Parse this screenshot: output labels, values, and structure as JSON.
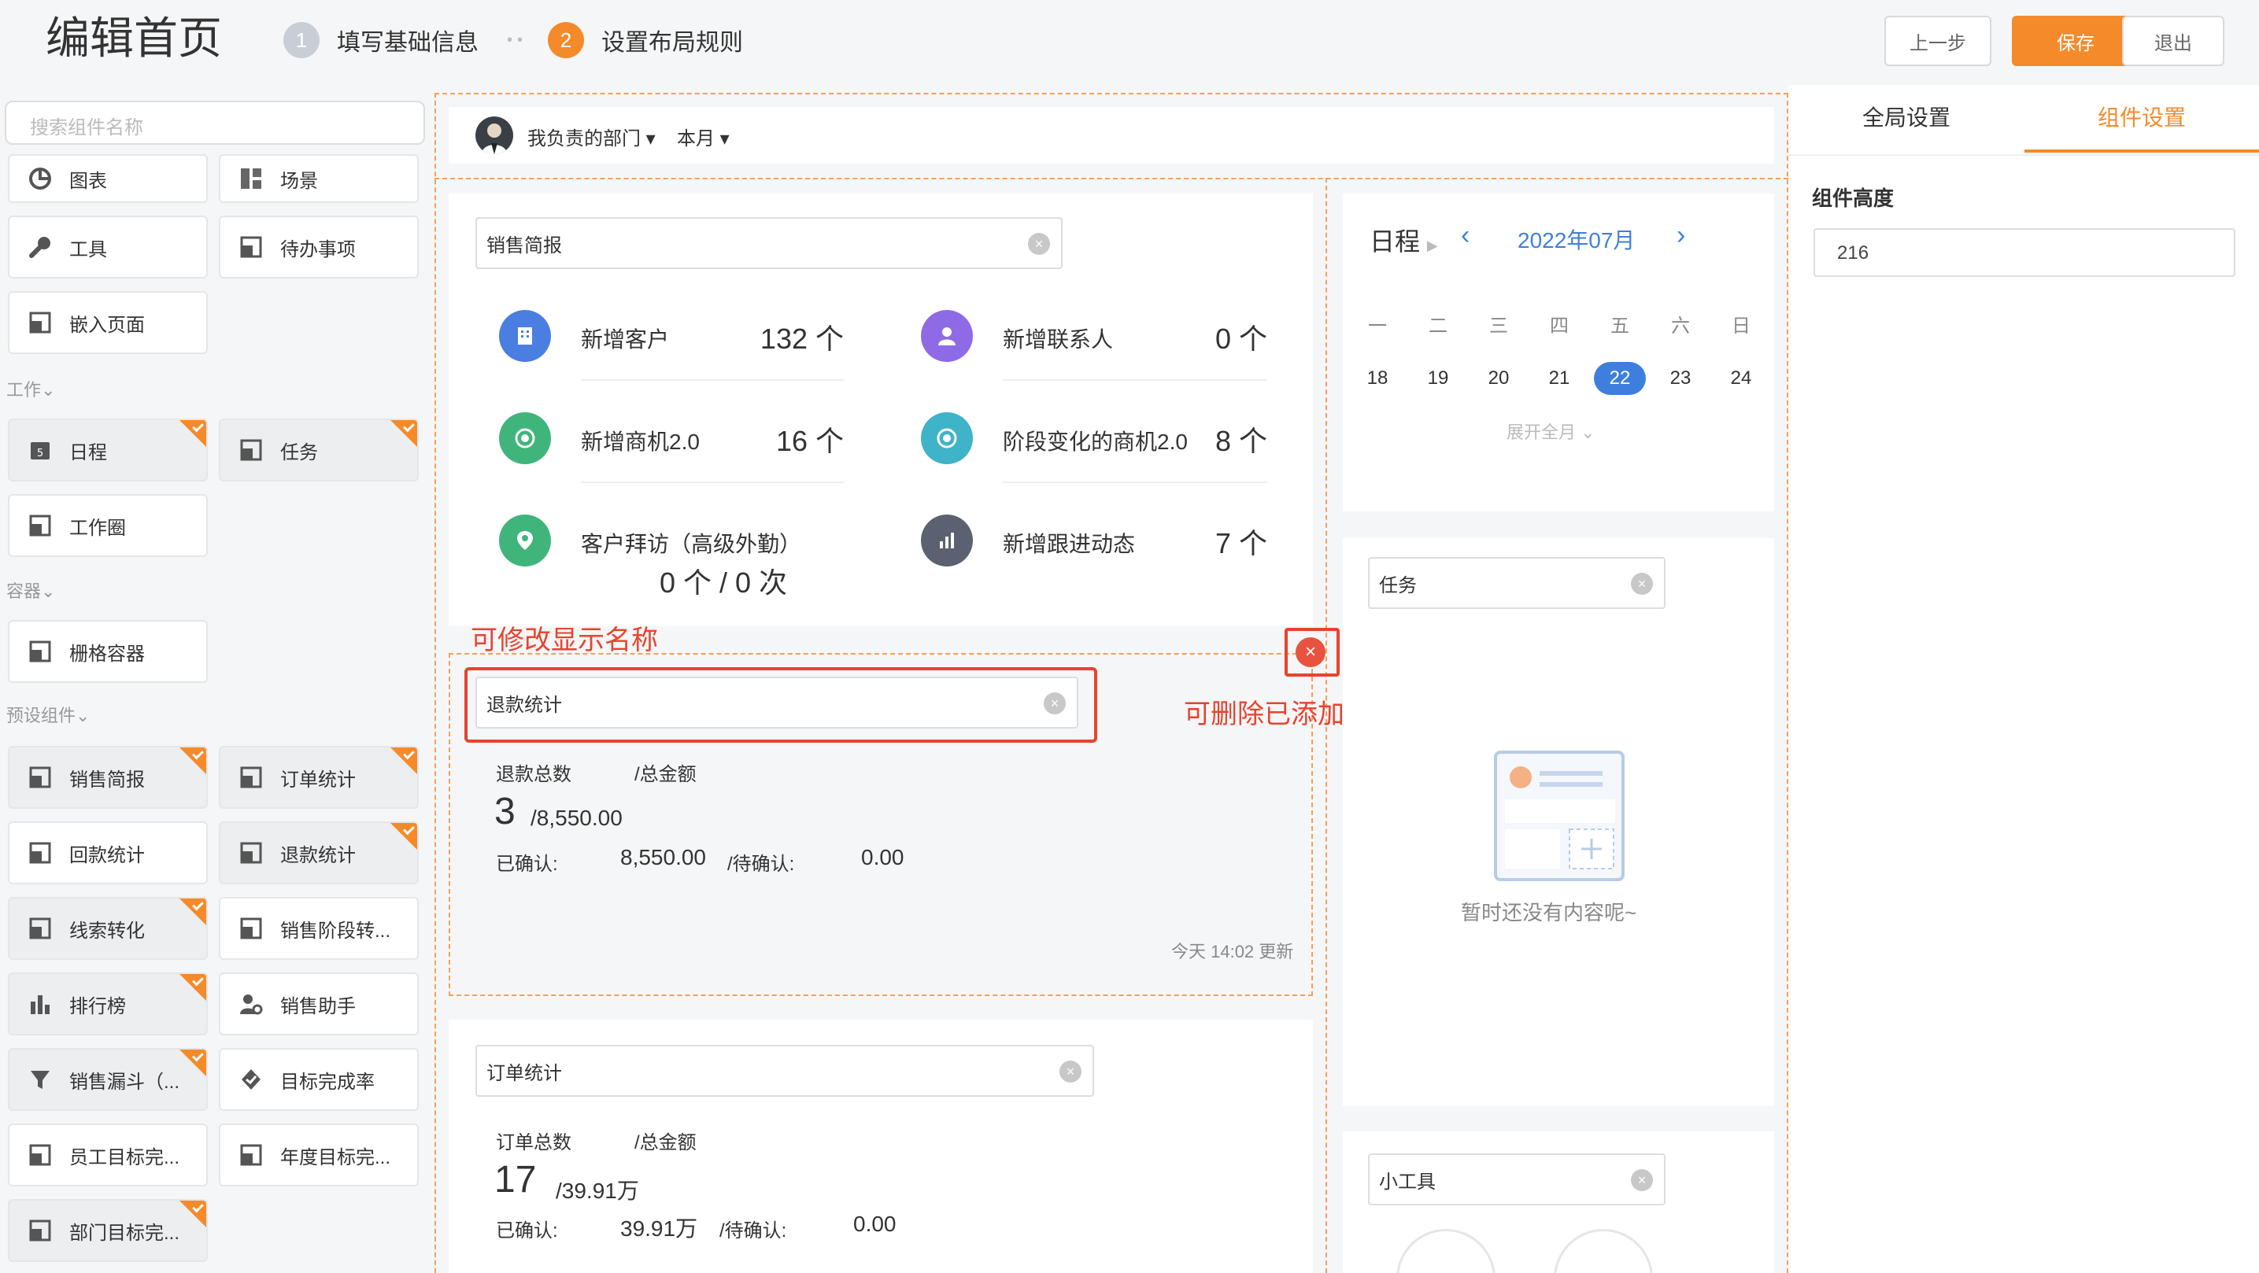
{
  "header": {
    "title": "编辑首页",
    "steps": [
      {
        "num": "1",
        "label": "填写基础信息"
      },
      {
        "num": "2",
        "label": "设置布局规则"
      }
    ],
    "buttons": {
      "prev": "上一步",
      "save": "保存",
      "exit": "退出"
    }
  },
  "left": {
    "search_placeholder": "搜索组件名称",
    "top_items": [
      "图表",
      "场景",
      "工具",
      "待办事项",
      "嵌入页面"
    ],
    "groups": {
      "work": "工作",
      "container": "容器",
      "preset": "预设组件"
    },
    "work_items": [
      "日程",
      "任务",
      "工作圈"
    ],
    "container_items": [
      "栅格容器"
    ],
    "preset_items": [
      "销售简报",
      "订单统计",
      "回款统计",
      "退款统计",
      "线索转化",
      "销售阶段转...",
      "排行榜",
      "销售助手",
      "销售漏斗（...",
      "目标完成率",
      "员工目标完...",
      "年度目标完...",
      "部门目标完..."
    ]
  },
  "toolbar": {
    "dept": "我负责的部门",
    "period": "本月"
  },
  "sales_brief": {
    "name": "销售简报",
    "metrics": [
      {
        "label": "新增客户",
        "value": "132 个"
      },
      {
        "label": "新增联系人",
        "value": "0 个"
      },
      {
        "label": "新增商机2.0",
        "value": "16 个"
      },
      {
        "label": "阶段变化的商机2.0",
        "value": "8 个"
      },
      {
        "label": "客户拜访（高级外勤）",
        "value": "0 个 / 0 次"
      },
      {
        "label": "新增跟进动态",
        "value": "7 个"
      }
    ]
  },
  "annotations": {
    "rename": "可修改显示名称",
    "delete": "可删除已添加的组件"
  },
  "refund": {
    "name": "退款统计",
    "count_label": "退款总数",
    "total_label": "/总金额",
    "count": "3",
    "total": "/8,550.00",
    "confirmed_label": "已确认:",
    "confirmed": "8,550.00",
    "pending_label": "/待确认:",
    "pending": "0.00",
    "updated": "今天 14:02 更新"
  },
  "order": {
    "name": "订单统计",
    "count_label": "订单总数",
    "total_label": "/总金额",
    "count": "17",
    "total": "/39.91万",
    "confirmed_label": "已确认:",
    "confirmed": "39.91万",
    "pending_label": "/待确认:",
    "pending": "0.00"
  },
  "calendar": {
    "title": "日程",
    "month": "2022年07月",
    "weekdays": [
      "一",
      "二",
      "三",
      "四",
      "五",
      "六",
      "日"
    ],
    "dates": [
      "18",
      "19",
      "20",
      "21",
      "22",
      "23",
      "24"
    ],
    "active": "22",
    "expand": "展开全月"
  },
  "task": {
    "name": "任务",
    "empty": "暂时还没有内容呢~"
  },
  "widget": {
    "name": "小工具"
  },
  "right": {
    "tabs": [
      "全局设置",
      "组件设置"
    ],
    "height_label": "组件高度",
    "height_value": "216"
  },
  "colors": {
    "accent": "#f58a2b",
    "alert": "#e8432e",
    "calendar_active": "#3e7fdd"
  }
}
